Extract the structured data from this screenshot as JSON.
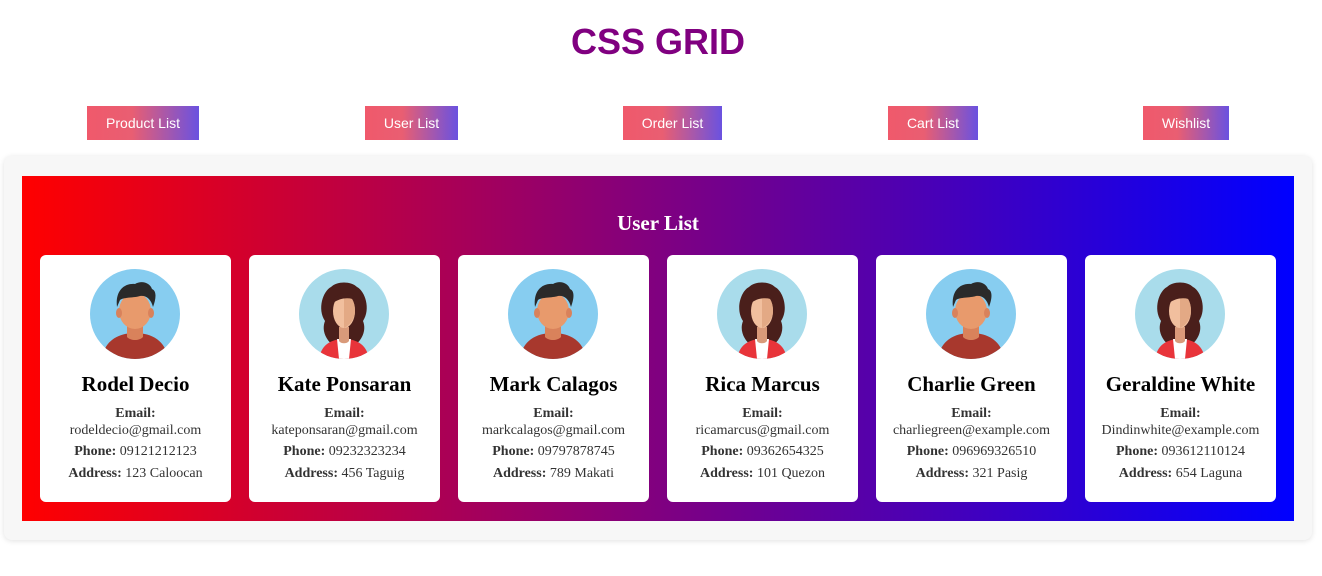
{
  "page": {
    "title": "CSS GRID"
  },
  "nav": [
    {
      "label": "Product List"
    },
    {
      "label": "User List"
    },
    {
      "label": "Order List"
    },
    {
      "label": "Cart List"
    },
    {
      "label": "Wishlist"
    }
  ],
  "panel": {
    "title": "User List"
  },
  "labels": {
    "email": "Email:",
    "phone": "Phone:",
    "address": "Address:"
  },
  "users": [
    {
      "name": "Rodel Decio",
      "email": "rodeldecio@gmail.com",
      "phone": "09121212123",
      "address": "123 Caloocan",
      "avatar": "male-avatar-icon"
    },
    {
      "name": "Kate Ponsaran",
      "email": "kateponsaran@gmail.com",
      "phone": "09232323234",
      "address": "456 Taguig",
      "avatar": "female-avatar-icon"
    },
    {
      "name": "Mark Calagos",
      "email": "markcalagos@gmail.com",
      "phone": "09797878745",
      "address": "789 Makati",
      "avatar": "male-avatar-icon"
    },
    {
      "name": "Rica Marcus",
      "email": "ricamarcus@gmail.com",
      "phone": "09362654325",
      "address": "101 Quezon",
      "avatar": "female-avatar-icon"
    },
    {
      "name": "Charlie Green",
      "email": "charliegreen@example.com",
      "phone": "096969326510",
      "address": "321 Pasig",
      "avatar": "male-avatar-icon"
    },
    {
      "name": "Geraldine White",
      "email": "Dindinwhite@example.com",
      "phone": "093612110124",
      "address": "654 Laguna",
      "avatar": "female-avatar-icon"
    }
  ],
  "colors": {
    "title": "#800080",
    "gradient_start": "#ff0000",
    "gradient_mid": "#800080",
    "gradient_end": "#0000ff",
    "button_start": "#f0596b",
    "button_end": "#6a52e0"
  }
}
